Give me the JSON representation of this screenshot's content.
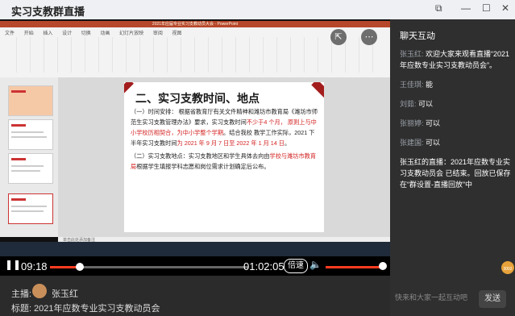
{
  "window": {
    "title": "实习支教群直播",
    "ctrl_min": "—",
    "ctrl_max": "☐",
    "ctrl_close": "✕",
    "ctrl_extra": "⧉"
  },
  "ppt": {
    "title_bar": "2021年应届专业实习支教动员大会 - PowerPoint",
    "tabs": [
      "文件",
      "开始",
      "插入",
      "设计",
      "切换",
      "动画",
      "幻灯片放映",
      "审阅",
      "视图"
    ],
    "slide_heading": "二、实习支教时间、地点",
    "para1": {
      "a": "（一）时间安排： 根据省教育厅有关文件精神和潍坊市教育局《潍坊市师 范生实习支教管理办法》要求，实习支教时间",
      "b": "不少于4 个月， 原则上与中小学校历相契合，为中小学整个学期",
      "c": "。结合我校 教学工作实际，2021 下半年实习支教时间",
      "d": "为 2021 年 9 月 7 日至 2022 年 1 月 14 日",
      "e": "。"
    },
    "para2": {
      "a": "（二）实习支教地点：实习支教地区和学生具体去向由",
      "b": "学校与潍坊市教育局",
      "c": "根据学生填报学科志愿和岗位需求计划确定后公布。"
    },
    "status": "单击此处添加备注"
  },
  "player": {
    "current_time": "09:18",
    "total_time": "01:02:05",
    "speed_label": "倍速",
    "progress": 0.15,
    "volume": 0.95
  },
  "footer": {
    "host_label": "主播:",
    "host_name": "张玉红",
    "title_label": "标题:",
    "title_value": "2021年应数专业实习支教动员会"
  },
  "chat": {
    "title": "聊天互动",
    "messages": [
      {
        "who": "张玉红:",
        "text": "欢迎大家来观看直播“2021年应数专业实习支教动员会”。"
      },
      {
        "who": "王佳琪:",
        "text": "能"
      },
      {
        "who": "刘茹:",
        "text": "可以"
      },
      {
        "who": "张丽婷:",
        "text": "可以"
      },
      {
        "who": "张建国:",
        "text": "可以"
      }
    ],
    "system": "张玉红的直播：2021年应数专业实习支教动员会 已结束。回放已保存在“群设置-直播回放”中",
    "like_count": "3002",
    "input_placeholder": "快来和大家一起互动吧",
    "send_label": "发送"
  }
}
